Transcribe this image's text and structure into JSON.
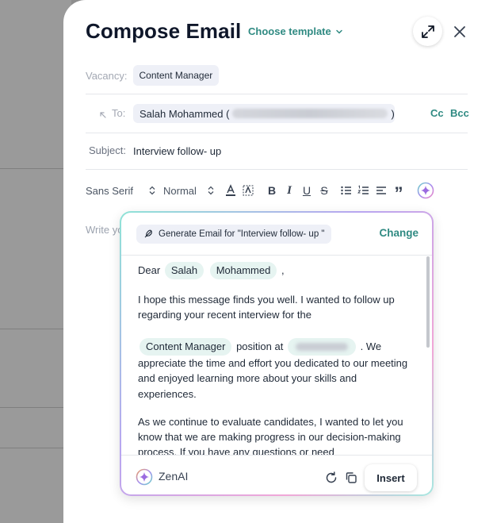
{
  "compose": {
    "title": "Compose Email",
    "template_label": "Choose template"
  },
  "fields": {
    "vacancy_label": "Vacancy:",
    "vacancy_value": "Content Manager",
    "to_label": "To:",
    "to_name": "Salah Mohammed (",
    "to_close": ")",
    "cc_label": "Cc",
    "bcc_label": "Bcc",
    "subject_label": "Subject:",
    "subject_value": "Interview follow- up"
  },
  "toolbar": {
    "font_family": "Sans Serif",
    "font_size": "Normal"
  },
  "editor": {
    "placeholder": "Write yo"
  },
  "ai_popup": {
    "generate_label": "Generate Email for \"Interview follow- up \"",
    "change_label": "Change",
    "body": {
      "greeting": "Dear",
      "first_name": "Salah",
      "last_name": "Mohammed",
      "greeting_end": ",",
      "p1_a": "I hope this message finds you well. I wanted to follow up regarding your recent interview for the",
      "p1_position": "Content Manager",
      "p1_b": "position at",
      "p1_c": ". We appreciate the time and effort you dedicated to our meeting and enjoyed learning more about your skills and experiences.",
      "p2": "As we continue to evaluate candidates, I wanted to let you know that we are making progress in our decision-making process. If you have any questions or need"
    },
    "footer": {
      "brand": "ZenAI",
      "insert_label": "Insert"
    }
  },
  "colors": {
    "accent": "#2f8a82",
    "chip_bg": "#eef0f7",
    "highlight_bg": "#e6f4f1"
  }
}
